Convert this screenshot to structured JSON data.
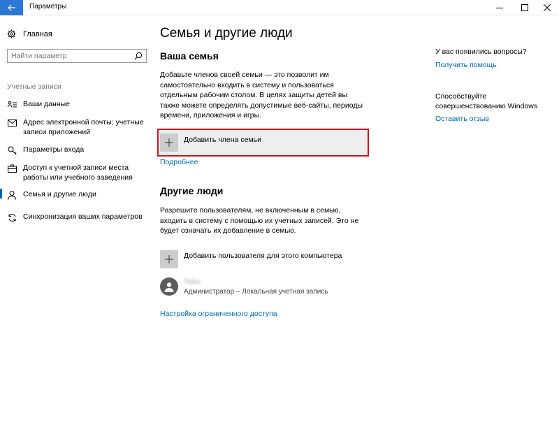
{
  "window": {
    "title": "Параметры"
  },
  "sidebar": {
    "home_label": "Главная",
    "search_placeholder": "Найти параметр",
    "section_label": "Учетные записи",
    "items": [
      {
        "label": "Ваши данные",
        "icon": "person-card-icon"
      },
      {
        "label": "Адрес электронной почты; учетные записи приложений",
        "icon": "mail-icon"
      },
      {
        "label": "Параметры входа",
        "icon": "key-icon"
      },
      {
        "label": "Доступ к учетной записи места работы или учебного заведения",
        "icon": "briefcase-icon"
      },
      {
        "label": "Семья и другие люди",
        "icon": "person-icon",
        "active": true
      },
      {
        "label": "Синхронизация ваших параметров",
        "icon": "sync-icon"
      }
    ]
  },
  "main": {
    "title": "Семья и другие люди",
    "family": {
      "heading": "Ваша семья",
      "description": "Добавьте членов своей семьи — это позволит им самостоятельно входить в систему и пользоваться отдельным рабочим столом. В целях защиты детей вы также можете определять допустимые веб-сайты, периоды времени, приложения и игры.",
      "add_label": "Добавить члена семьи",
      "more_link": "Подробнее"
    },
    "others": {
      "heading": "Другие люди",
      "description": "Разрешите пользователям, не включенным в семью, входить в систему с помощью их учетных записей. Это не будет означать их добавление в семью.",
      "add_label": "Добавить пользователя для этого компьютера",
      "user": {
        "name": "Tejka",
        "subtitle": "Администратор – Локальная учетная запись"
      },
      "restricted_link": "Настройка ограниченного доступа"
    }
  },
  "right": {
    "question": "У вас появились вопросы?",
    "help_link": "Получить помощь",
    "improve": "Способствуйте совершенствованию Windows",
    "feedback_link": "Оставить отзыв"
  },
  "colors": {
    "accent": "#2b78d4",
    "link": "#0066b4",
    "highlight": "#d0141e"
  }
}
